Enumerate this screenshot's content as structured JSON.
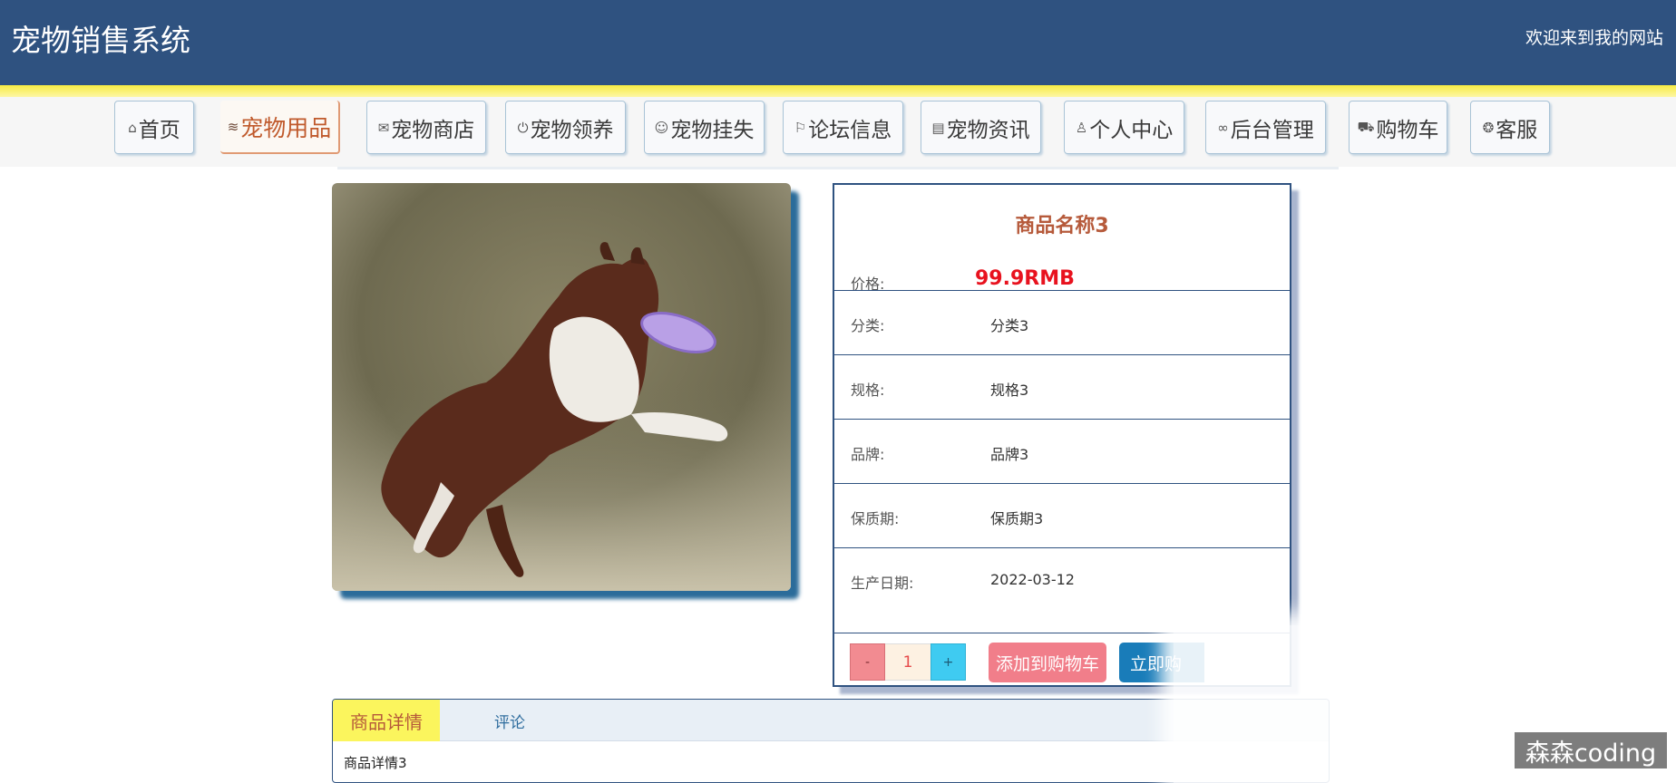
{
  "header": {
    "title": "宠物销售系统",
    "welcome": "欢迎来到我的网站"
  },
  "nav": {
    "items": [
      {
        "label": "首页",
        "icon": "home-icon",
        "glyph": "⌂"
      },
      {
        "label": "宠物用品",
        "icon": "layers-icon",
        "glyph": "≋"
      },
      {
        "label": "宠物商店",
        "icon": "envelope-icon",
        "glyph": "✉"
      },
      {
        "label": "宠物领养",
        "icon": "power-icon",
        "glyph": "⏻"
      },
      {
        "label": "宠物挂失",
        "icon": "palette-icon",
        "glyph": "☺"
      },
      {
        "label": "论坛信息",
        "icon": "flag-icon",
        "glyph": "⚐"
      },
      {
        "label": "宠物资讯",
        "icon": "clipboard-icon",
        "glyph": "▤"
      },
      {
        "label": "个人中心",
        "icon": "user-icon",
        "glyph": "♙"
      },
      {
        "label": "后台管理",
        "icon": "link-icon",
        "glyph": "∞"
      },
      {
        "label": "购物车",
        "icon": "cart-icon",
        "glyph": "⛟"
      },
      {
        "label": "客服",
        "icon": "chat-icon",
        "glyph": "❂"
      }
    ],
    "active": "宠物用品"
  },
  "product": {
    "name": "商品名称3",
    "price_label": "价格:",
    "price": "99.9RMB",
    "fields": [
      {
        "label": "分类:",
        "value": "分类3"
      },
      {
        "label": "规格:",
        "value": "规格3"
      },
      {
        "label": "品牌:",
        "value": "品牌3"
      },
      {
        "label": "保质期:",
        "value": "保质期3"
      },
      {
        "label": "生产日期:",
        "value": "2022-03-12"
      }
    ]
  },
  "actions": {
    "minus": "-",
    "quantity": "1",
    "plus": "+",
    "add_cart": "添加到购物车",
    "buy_now": "立即购"
  },
  "tabs": {
    "detail": "商品详情",
    "comment": "评论",
    "content": "商品详情3"
  },
  "watermark": "森森coding",
  "colors": {
    "header_bg": "#2f5280",
    "accent": "#b65a3b",
    "price": "#e8121e",
    "add_cart": "#f17e8a",
    "buy_now": "#197cb9"
  }
}
